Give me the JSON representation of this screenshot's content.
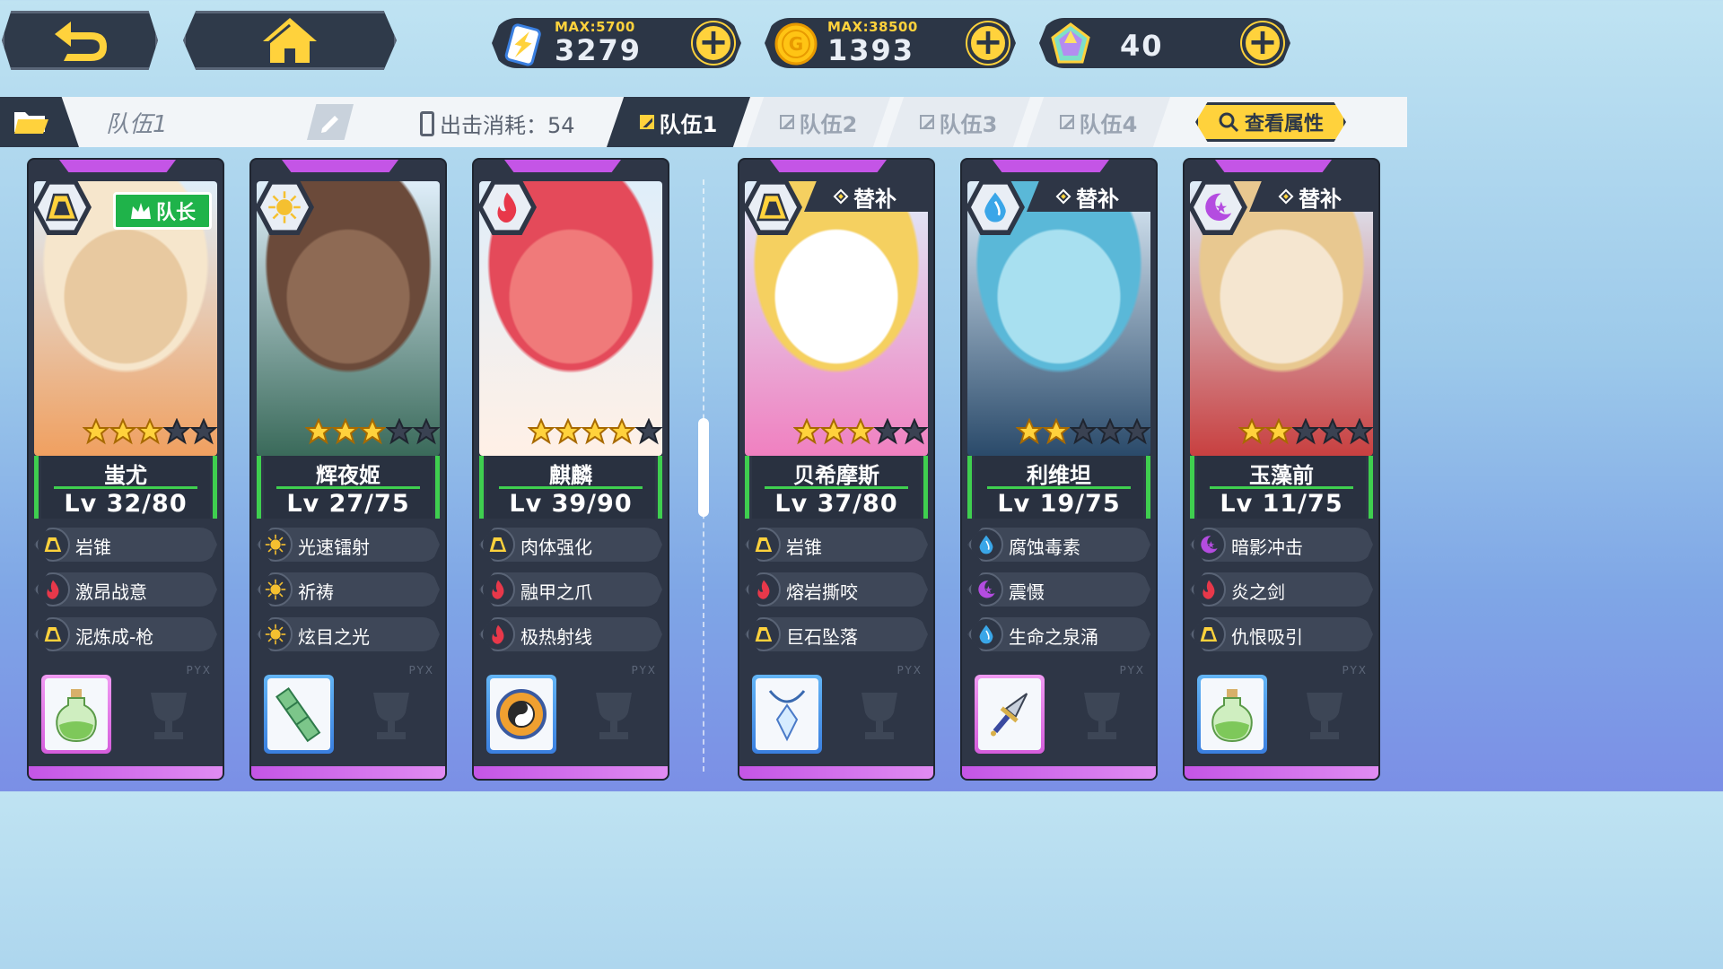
{
  "top_bar": {
    "back_icon": "back-arrow-icon",
    "home_icon": "home-icon",
    "resources": [
      {
        "name": "energy",
        "icon": "energy-battery-icon",
        "max_label": "MAX:5700",
        "value": "3279",
        "plus": "+"
      },
      {
        "name": "gold",
        "icon": "gold-coin-icon",
        "max_label": "MAX:38500",
        "value": "1393",
        "plus": "+"
      },
      {
        "name": "crystal",
        "icon": "crystal-gem-icon",
        "max_label": "",
        "value": "40",
        "plus": "+"
      }
    ]
  },
  "team_bar": {
    "team_name": "队伍1",
    "cost_label": "出击消耗：54",
    "tabs": [
      {
        "label": "队伍1",
        "active": true
      },
      {
        "label": "队伍2",
        "active": false
      },
      {
        "label": "队伍3",
        "active": false
      },
      {
        "label": "队伍4",
        "active": false
      }
    ],
    "attr_button": "查看属性"
  },
  "badges": {
    "leader": "队长",
    "substitute": "替补"
  },
  "pyx_mark": "PYX",
  "colors": {
    "accent_yellow": "#ffd23c",
    "panel_dark": "#2e3646",
    "green": "#3fcf4f",
    "purple": "#c455e6"
  },
  "cards": [
    {
      "name": "蚩尤",
      "level": "Lv 32/80",
      "element": "rock",
      "stars": 3,
      "max_stars": 5,
      "role": "leader",
      "skills": [
        {
          "element": "rock",
          "name": "岩锥"
        },
        {
          "element": "fire",
          "name": "激昂战意"
        },
        {
          "element": "rock",
          "name": "泥炼成-枪"
        }
      ],
      "item": {
        "icon": "potion-bottle-icon",
        "frame": "purple"
      }
    },
    {
      "name": "辉夜姬",
      "level": "Lv 27/75",
      "element": "light",
      "stars": 3,
      "max_stars": 5,
      "role": "member",
      "skills": [
        {
          "element": "light",
          "name": "光速镭射"
        },
        {
          "element": "light",
          "name": "祈祷"
        },
        {
          "element": "light",
          "name": "炫目之光"
        }
      ],
      "item": {
        "icon": "bamboo-icon",
        "frame": "blue"
      }
    },
    {
      "name": "麒麟",
      "level": "Lv 39/90",
      "element": "fire",
      "stars": 4,
      "max_stars": 5,
      "role": "member",
      "skills": [
        {
          "element": "rock",
          "name": "肉体强化"
        },
        {
          "element": "fire",
          "name": "融甲之爪"
        },
        {
          "element": "fire",
          "name": "极热射线"
        }
      ],
      "item": {
        "icon": "compass-disc-icon",
        "frame": "blue"
      }
    },
    {
      "name": "贝希摩斯",
      "level": "Lv 37/80",
      "element": "rock",
      "stars": 3,
      "max_stars": 5,
      "role": "substitute",
      "skills": [
        {
          "element": "rock",
          "name": "岩锥"
        },
        {
          "element": "fire",
          "name": "熔岩撕咬"
        },
        {
          "element": "rock",
          "name": "巨石坠落"
        }
      ],
      "item": {
        "icon": "crystal-pendant-icon",
        "frame": "blue"
      }
    },
    {
      "name": "利维坦",
      "level": "Lv 19/75",
      "element": "water",
      "stars": 2,
      "max_stars": 5,
      "role": "substitute",
      "skills": [
        {
          "element": "water",
          "name": "腐蚀毒素"
        },
        {
          "element": "dark",
          "name": "震慑"
        },
        {
          "element": "water",
          "name": "生命之泉涌"
        }
      ],
      "item": {
        "icon": "dagger-icon",
        "frame": "purple"
      }
    },
    {
      "name": "玉藻前",
      "level": "Lv 11/75",
      "element": "dark",
      "stars": 2,
      "max_stars": 5,
      "role": "substitute",
      "skills": [
        {
          "element": "dark",
          "name": "暗影冲击"
        },
        {
          "element": "fire",
          "name": "炎之剑"
        },
        {
          "element": "rock",
          "name": "仇恨吸引"
        }
      ],
      "item": {
        "icon": "potion-bottle-icon",
        "frame": "blue"
      }
    }
  ]
}
